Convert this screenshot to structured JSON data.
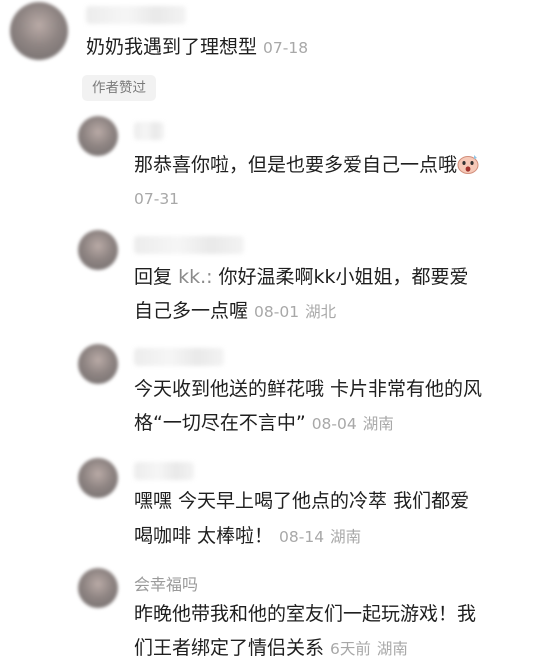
{
  "main_comment": {
    "text": "奶奶我遇到了理想型",
    "date": "07-18",
    "badge": "作者赞过"
  },
  "replies": [
    {
      "text": "那恭喜你啦，但是也要多爱自己一点哦",
      "emoji_icon": "shocked-face-emoji-icon",
      "date": "07-31"
    },
    {
      "prefix": "回复",
      "mention": "kk.:",
      "line1": " 你好温柔啊kk小姐姐，都要爱",
      "line2": "自己多一点喔",
      "date": "08-01",
      "location": "湖北"
    },
    {
      "line1": "今天收到他送的鲜花哦 卡片非常有他的风",
      "line2": "格“一切尽在不言中”",
      "date": "08-04",
      "location": "湖南"
    },
    {
      "line1": "嘿嘿 今天早上喝了他点的冷萃 我们都爱",
      "line2": "喝咖啡 太棒啦！",
      "date": "08-14",
      "location": "湖南"
    },
    {
      "username": "会幸福吗",
      "line1": "昨晚他带我和他的室友们一起玩游戏！我",
      "line2": "们王者绑定了情侣关系",
      "date": "6天前",
      "location": "湖南"
    }
  ]
}
